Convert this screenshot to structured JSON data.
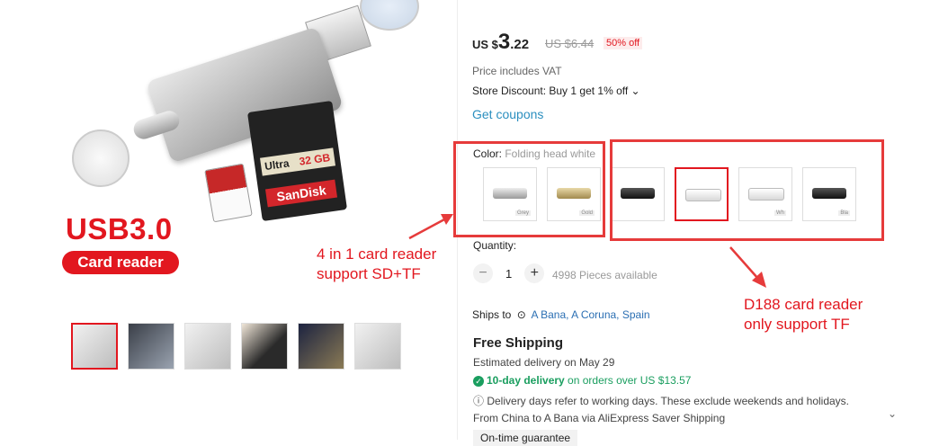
{
  "hero": {
    "title": "USB3.0",
    "pill": "Card reader",
    "sd_brand": "SanDisk",
    "sd_capacity": "32 GB",
    "sd_model": "Ultra"
  },
  "thumbnails": [
    {
      "id": "thumb-1",
      "selected": true
    },
    {
      "id": "thumb-2",
      "selected": false
    },
    {
      "id": "thumb-3",
      "selected": false
    },
    {
      "id": "thumb-4",
      "selected": false
    },
    {
      "id": "thumb-5",
      "selected": false
    },
    {
      "id": "thumb-6",
      "selected": false
    }
  ],
  "price": {
    "currency": "US $",
    "whole": "3",
    "cents": ".22",
    "original": "US $6.44",
    "discount": "50% off"
  },
  "vat": "Price includes VAT",
  "store_discount": "Store Discount: Buy 1 get 1% off ⌄",
  "coupons": "Get coupons",
  "color": {
    "label": "Color: ",
    "value": "Folding head white"
  },
  "variants": [
    {
      "tag": "Grey",
      "style": "silver"
    },
    {
      "tag": "Gold",
      "style": "gold"
    },
    {
      "tag": "",
      "style": "black"
    },
    {
      "tag": "",
      "style": "white",
      "selected": true
    },
    {
      "tag": "Wh",
      "style": "white"
    },
    {
      "tag": "Bla",
      "style": "black"
    }
  ],
  "quantity": {
    "label": "Quantity:",
    "value": "1",
    "minus": "−",
    "plus": "+",
    "available": "4998 Pieces available"
  },
  "ships": {
    "label": "Ships to",
    "location": "A Bana, A Coruna, Spain"
  },
  "shipping": {
    "title": "Free Shipping",
    "estimate": "Estimated delivery on May 29",
    "ten_day": "10-day delivery",
    "ten_day_rest": " on orders over US $13.57",
    "note": "Delivery days refer to working days. These exclude weekends and holidays.",
    "from": "From China to A Bana via AliExpress Saver Shipping",
    "ontime": "On-time guarantee"
  },
  "annotations": {
    "a1_line1": "4 in 1 card reader",
    "a1_line2": "support SD+TF",
    "a2_line1": "D188 card reader",
    "a2_line2": "only support TF"
  },
  "colors": {
    "accent": "#e2171f",
    "annotation": "#e63b3b",
    "link": "#2b8fbf",
    "green": "#1a9e5f"
  }
}
